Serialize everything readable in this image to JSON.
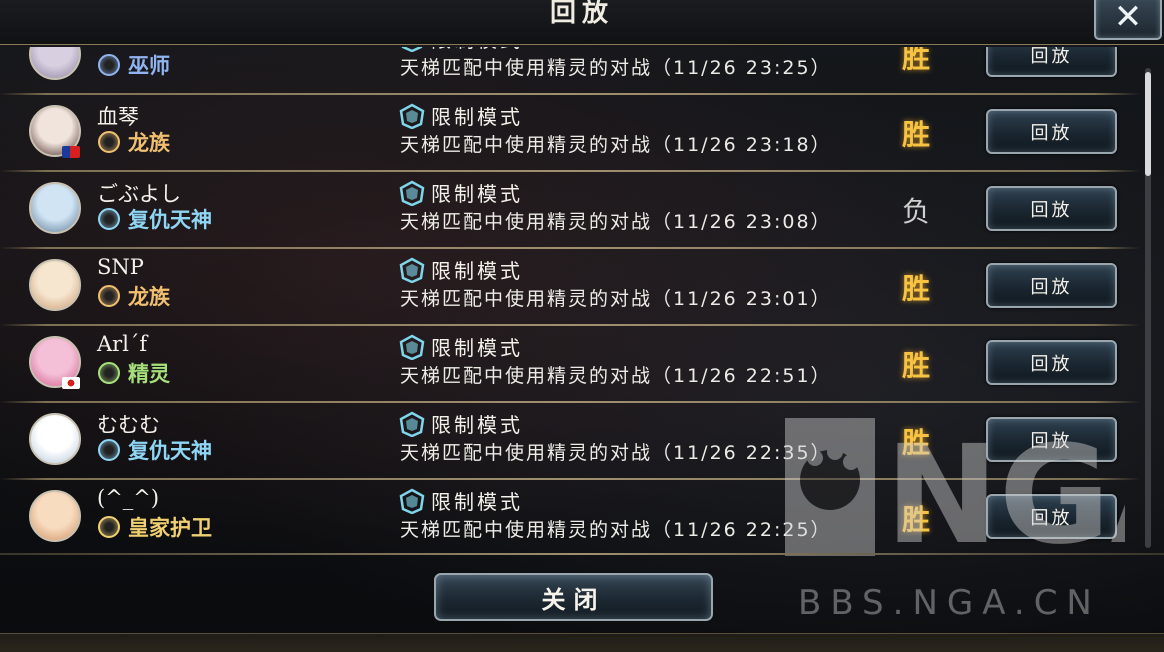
{
  "header": {
    "title": "回放",
    "close_icon": "close-icon"
  },
  "rows": [
    {
      "name": "",
      "class": "巫师",
      "class_color": "#8fb4f0",
      "mode": "限制模式",
      "desc": "天梯匹配中使用精灵的对战（11/26 23:25）",
      "result": "胜",
      "replay": "回放",
      "flag": ""
    },
    {
      "name": "血琴",
      "class": "龙族",
      "class_color": "#f0c070",
      "mode": "限制模式",
      "desc": "天梯匹配中使用精灵的对战（11/26 23:18）",
      "result": "胜",
      "replay": "回放",
      "flag": "taiwan"
    },
    {
      "name": "ごぶよし",
      "class": "复仇天神",
      "class_color": "#8fd6f5",
      "mode": "限制模式",
      "desc": "天梯匹配中使用精灵的对战（11/26 23:08）",
      "result": "负",
      "replay": "回放",
      "flag": ""
    },
    {
      "name": "SNP",
      "class": "龙族",
      "class_color": "#f0c070",
      "mode": "限制模式",
      "desc": "天梯匹配中使用精灵的对战（11/26 23:01）",
      "result": "胜",
      "replay": "回放",
      "flag": ""
    },
    {
      "name": "Arl´f",
      "class": "精灵",
      "class_color": "#a6e07a",
      "mode": "限制模式",
      "desc": "天梯匹配中使用精灵的对战（11/26 22:51）",
      "result": "胜",
      "replay": "回放",
      "flag": "japan"
    },
    {
      "name": "むむむ",
      "class": "复仇天神",
      "class_color": "#8fd6f5",
      "mode": "限制模式",
      "desc": "天梯匹配中使用精灵的对战（11/26 22:35）",
      "result": "胜",
      "replay": "回放",
      "flag": ""
    },
    {
      "name": "(^_^)",
      "class": "皇家护卫",
      "class_color": "#f0d070",
      "mode": "限制模式",
      "desc": "天梯匹配中使用精灵的对战（11/26 22:25）",
      "result": "胜",
      "replay": "回放",
      "flag": ""
    }
  ],
  "colors": {
    "win": "#f6c343",
    "loss": "#cfcfcf",
    "mode_icon": "#7fd6ea"
  },
  "footer": {
    "close_label": "关闭"
  },
  "watermark": {
    "logo_text": "NGA",
    "site_text": "BBS.NGA.CN"
  }
}
